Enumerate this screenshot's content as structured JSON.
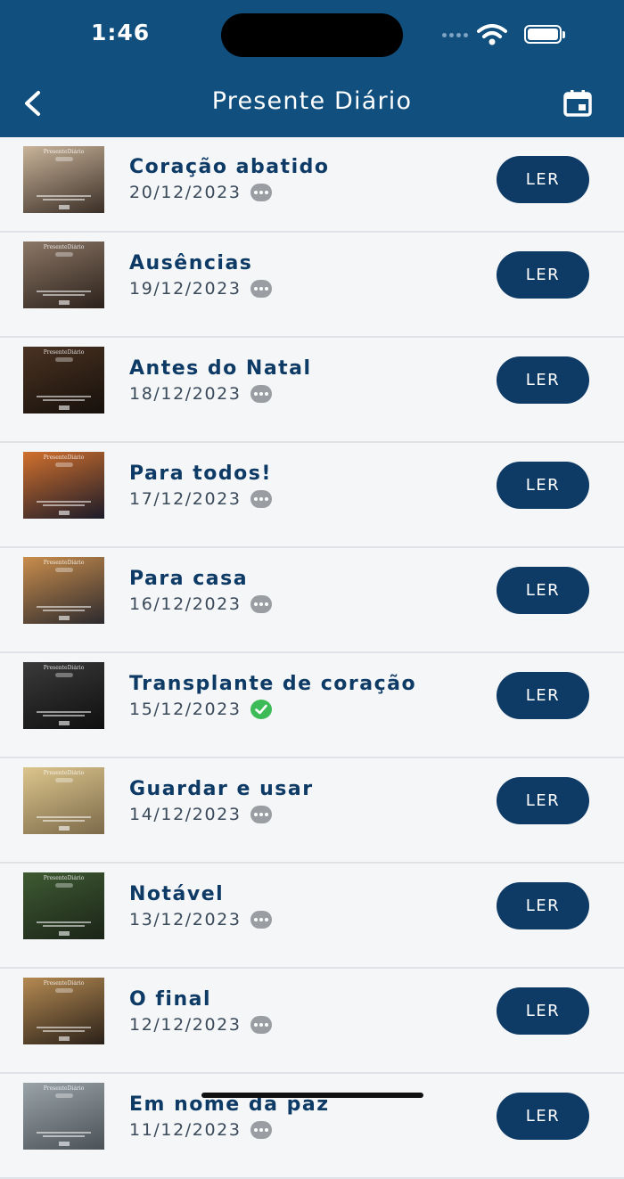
{
  "status_bar": {
    "time": "1:46"
  },
  "nav": {
    "title": "Presente Diário"
  },
  "thumb_label": "PresenteDiário",
  "items": [
    {
      "title": "Coração abatido",
      "date": "20/12/2023",
      "status": "pending",
      "button": "LER",
      "colors": [
        "#c9b49a",
        "#3a2e26"
      ]
    },
    {
      "title": "Ausências",
      "date": "19/12/2023",
      "status": "pending",
      "button": "LER",
      "colors": [
        "#8c7766",
        "#2b211b"
      ]
    },
    {
      "title": "Antes do Natal",
      "date": "18/12/2023",
      "status": "pending",
      "button": "LER",
      "colors": [
        "#4a3222",
        "#16100b"
      ]
    },
    {
      "title": "Para todos!",
      "date": "17/12/2023",
      "status": "pending",
      "button": "LER",
      "colors": [
        "#d1702c",
        "#1b1b2a"
      ]
    },
    {
      "title": "Para casa",
      "date": "16/12/2023",
      "status": "pending",
      "button": "LER",
      "colors": [
        "#c98d4c",
        "#2c2a2e"
      ]
    },
    {
      "title": "Transplante de coração",
      "date": "15/12/2023",
      "status": "done",
      "button": "LER",
      "colors": [
        "#3a3a3a",
        "#0f0f0f"
      ]
    },
    {
      "title": "Guardar e usar",
      "date": "14/12/2023",
      "status": "pending",
      "button": "LER",
      "colors": [
        "#dcc58c",
        "#7c6a4a"
      ]
    },
    {
      "title": "Notável",
      "date": "13/12/2023",
      "status": "pending",
      "button": "LER",
      "colors": [
        "#3e5a32",
        "#1b2418"
      ]
    },
    {
      "title": "O final",
      "date": "12/12/2023",
      "status": "pending",
      "button": "LER",
      "colors": [
        "#b58a52",
        "#2a2119"
      ]
    },
    {
      "title": "Em nome da paz",
      "date": "11/12/2023",
      "status": "pending",
      "button": "LER",
      "colors": [
        "#9aa3a8",
        "#4a5258"
      ]
    }
  ]
}
